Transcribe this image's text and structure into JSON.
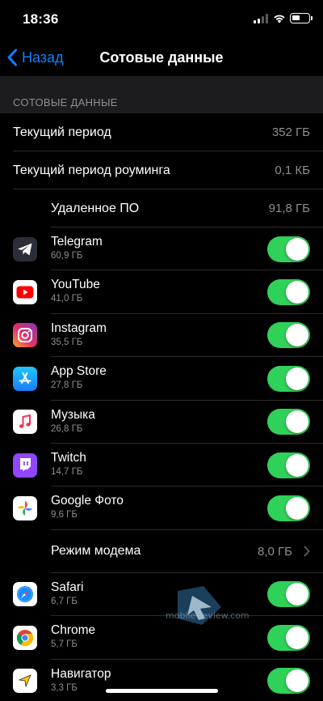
{
  "status": {
    "time": "18:36"
  },
  "nav": {
    "back_label": "Назад",
    "title": "Сотовые данные"
  },
  "section_header": "СОТОВЫЕ ДАННЫЕ",
  "stats": [
    {
      "label": "Текущий период",
      "value": "352 ГБ"
    },
    {
      "label": "Текущий период роуминга",
      "value": "0,1 КБ"
    },
    {
      "label": "Удаленное ПО",
      "value": "91,8 ГБ"
    }
  ],
  "apps_a": [
    {
      "name": "Telegram",
      "size": "60,9 ГБ",
      "icon": "telegram-icon",
      "enabled": true
    },
    {
      "name": "YouTube",
      "size": "41,0 ГБ",
      "icon": "youtube-icon",
      "enabled": true
    },
    {
      "name": "Instagram",
      "size": "35,5 ГБ",
      "icon": "instagram-icon",
      "enabled": true
    },
    {
      "name": "App Store",
      "size": "27,8 ГБ",
      "icon": "app-store-icon",
      "enabled": true
    },
    {
      "name": "Музыка",
      "size": "26,8 ГБ",
      "icon": "music-icon",
      "enabled": true
    },
    {
      "name": "Twitch",
      "size": "14,7 ГБ",
      "icon": "twitch-icon",
      "enabled": true
    },
    {
      "name": "Google Фото",
      "size": "9,6 ГБ",
      "icon": "google-photos-icon",
      "enabled": true
    }
  ],
  "modem": {
    "label": "Режим модема",
    "value": "8,0 ГБ"
  },
  "apps_b": [
    {
      "name": "Safari",
      "size": "6,7 ГБ",
      "icon": "safari-icon",
      "enabled": true
    },
    {
      "name": "Chrome",
      "size": "5,7 ГБ",
      "icon": "chrome-icon",
      "enabled": true
    },
    {
      "name": "Навигатор",
      "size": "3,3 ГБ",
      "icon": "navigator-icon",
      "enabled": true
    }
  ],
  "watermark": "mobile-review.com",
  "colors": {
    "accent": "#0a84ff",
    "toggle_on": "#30d158",
    "background": "#000000",
    "grouped_bg": "#1c1c1e",
    "secondary_text": "#8e8e93"
  }
}
